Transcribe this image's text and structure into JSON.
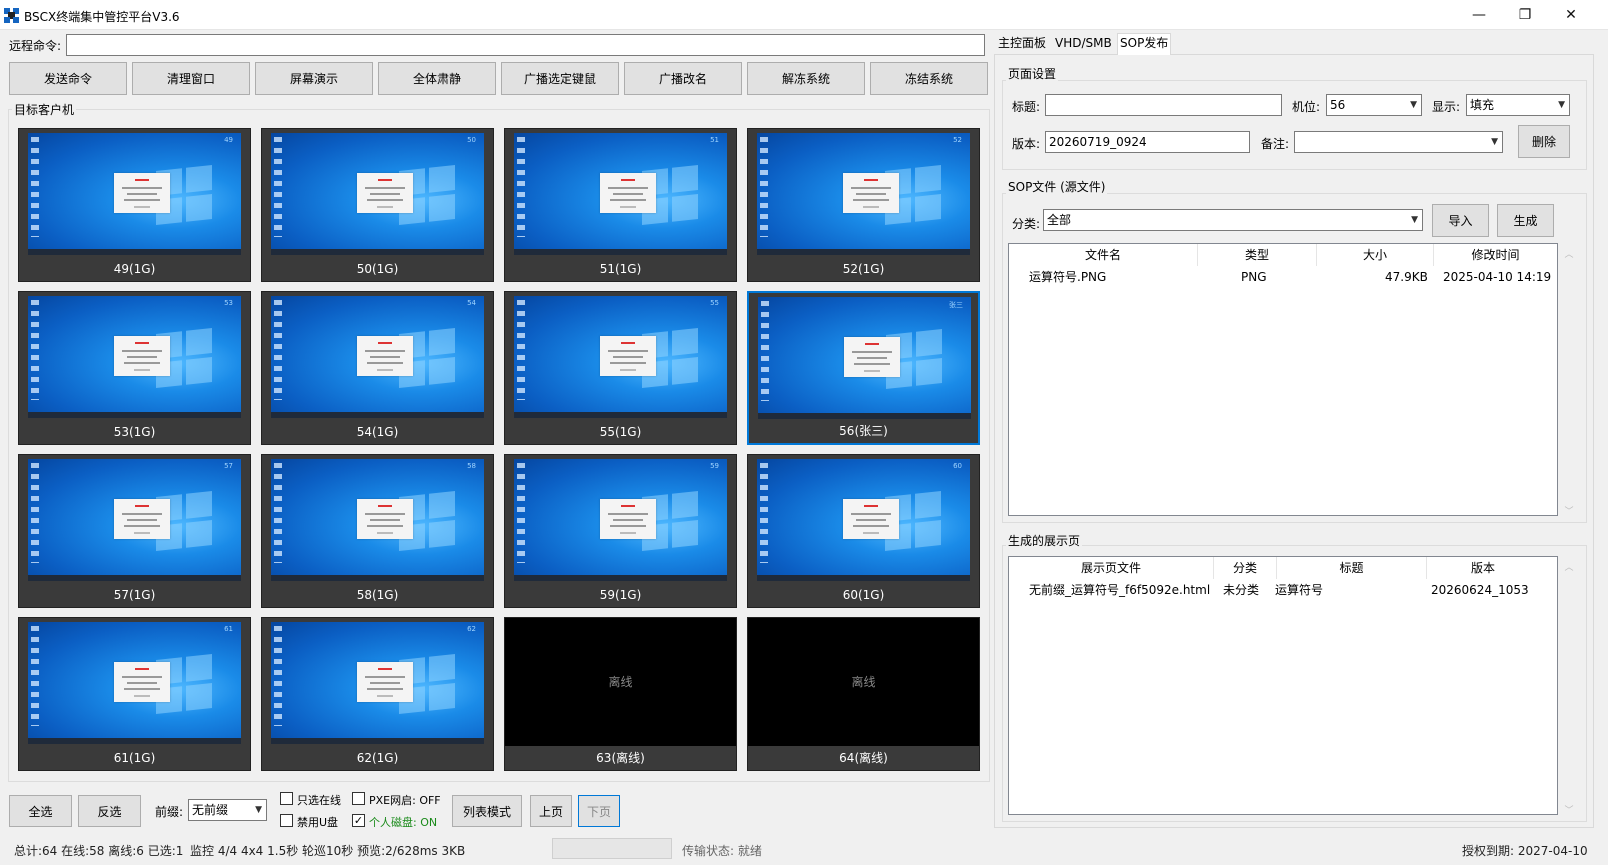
{
  "window": {
    "title": "BSCX终端集中管控平台V3.6",
    "minimize": "—",
    "restore": "❐",
    "close": "✕"
  },
  "command": {
    "label": "远程命令:",
    "value": ""
  },
  "toolbar": [
    "发送命令",
    "清理窗口",
    "屏幕演示",
    "全体肃静",
    "广播选定键鼠",
    "广播改名",
    "解冻系统",
    "冻结系统"
  ],
  "clients": {
    "group_label": "目标客户机",
    "tiles": [
      {
        "caption": "49(1G)",
        "corner": "49",
        "online": true,
        "selected": false
      },
      {
        "caption": "50(1G)",
        "corner": "50",
        "online": true,
        "selected": false
      },
      {
        "caption": "51(1G)",
        "corner": "51",
        "online": true,
        "selected": false
      },
      {
        "caption": "52(1G)",
        "corner": "52",
        "online": true,
        "selected": false
      },
      {
        "caption": "53(1G)",
        "corner": "53",
        "online": true,
        "selected": false
      },
      {
        "caption": "54(1G)",
        "corner": "54",
        "online": true,
        "selected": false
      },
      {
        "caption": "55(1G)",
        "corner": "55",
        "online": true,
        "selected": false
      },
      {
        "caption": "56(张三)",
        "corner": "张三",
        "online": true,
        "selected": true
      },
      {
        "caption": "57(1G)",
        "corner": "57",
        "online": true,
        "selected": false
      },
      {
        "caption": "58(1G)",
        "corner": "58",
        "online": true,
        "selected": false
      },
      {
        "caption": "59(1G)",
        "corner": "59",
        "online": true,
        "selected": false
      },
      {
        "caption": "60(1G)",
        "corner": "60",
        "online": true,
        "selected": false
      },
      {
        "caption": "61(1G)",
        "corner": "61",
        "online": true,
        "selected": false
      },
      {
        "caption": "62(1G)",
        "corner": "62",
        "online": true,
        "selected": false
      },
      {
        "caption": "63(离线)",
        "corner": "",
        "online": false,
        "selected": false,
        "offline_text": "离线"
      },
      {
        "caption": "64(离线)",
        "corner": "",
        "online": false,
        "selected": false,
        "offline_text": "离线"
      }
    ]
  },
  "bottom": {
    "select_all": "全选",
    "invert": "反选",
    "prefix_label": "前缀:",
    "prefix_value": "无前缀",
    "only_online": "只选在线",
    "only_online_checked": false,
    "pxe": "PXE网启: OFF",
    "pxe_checked": false,
    "disable_usb": "禁用U盘",
    "disable_usb_checked": false,
    "personal_disk": "个人磁盘: ON",
    "personal_disk_checked": true,
    "list_mode": "列表模式",
    "prev_page": "上页",
    "next_page": "下页"
  },
  "status": {
    "summary": "总计:64 在线:58 离线:6 已选:1",
    "monitor": "监控 4/4 4x4 1.5秒 轮巡10秒 预览:2/628ms 3KB",
    "transfer": "传输状态: 就绪",
    "license": "授权到期: 2027-04-10"
  },
  "tabs": [
    {
      "label": "主控面板",
      "active": false
    },
    {
      "label": "VHD/SMB",
      "active": false
    },
    {
      "label": "SOP发布",
      "active": true
    }
  ],
  "page_settings": {
    "group_label": "页面设置",
    "title_label": "标题:",
    "title_value": "",
    "seat_label": "机位:",
    "seat_value": "56",
    "display_label": "显示:",
    "display_value": "填充",
    "version_label": "版本:",
    "version_value": "20260719_0924",
    "note_label": "备注:",
    "note_value": "",
    "delete_button": "删除"
  },
  "sop_files": {
    "group_label": "SOP文件 (源文件)",
    "category_label": "分类:",
    "category_value": "全部",
    "import_button": "导入",
    "generate_button": "生成",
    "headers": [
      "文件名",
      "类型",
      "大小",
      "修改时间"
    ],
    "rows": [
      [
        "运算符号.PNG",
        "PNG",
        "47.9KB",
        "2025-04-10 14:19"
      ]
    ]
  },
  "pages": {
    "group_label": "生成的展示页",
    "headers": [
      "展示页文件",
      "分类",
      "标题",
      "版本"
    ],
    "rows": [
      [
        "无前缀_运算符号_f6f5092e.html",
        "未分类",
        "运算符号",
        "20260624_1053"
      ]
    ]
  },
  "colors": {
    "accent": "#0078d7",
    "tile_bg": "#3a3a3a",
    "green": "#1a8a1a"
  }
}
